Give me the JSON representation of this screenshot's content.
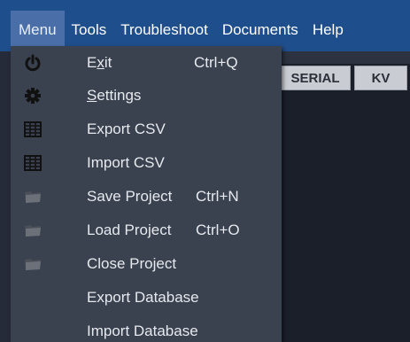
{
  "menubar": {
    "items": [
      {
        "label": "Menu",
        "active": true
      },
      {
        "label": "Tools"
      },
      {
        "label": "Troubleshoot"
      },
      {
        "label": "Documents"
      },
      {
        "label": "Help"
      }
    ]
  },
  "tabs": [
    {
      "label": "SERIAL"
    },
    {
      "label": "KV"
    }
  ],
  "menu": {
    "items": [
      {
        "label": "Exit",
        "mnemonic": "x",
        "shortcut": "Ctrl+Q",
        "icon": "power-icon"
      },
      {
        "label": "Settings",
        "mnemonic": "S",
        "shortcut": "",
        "icon": "gear-icon"
      },
      {
        "label": "Export CSV",
        "shortcut": "",
        "icon": "grid-icon"
      },
      {
        "label": "Import CSV",
        "shortcut": "",
        "icon": "grid-icon"
      },
      {
        "label": "Save Project",
        "shortcut": "Ctrl+N",
        "icon": "folder-icon"
      },
      {
        "label": "Load Project",
        "shortcut": "Ctrl+O",
        "icon": "folder-icon"
      },
      {
        "label": "Close Project",
        "shortcut": "",
        "icon": "folder-icon"
      },
      {
        "label": "Export Database",
        "shortcut": "",
        "icon": ""
      },
      {
        "label": "Import Database",
        "shortcut": "",
        "icon": ""
      }
    ]
  },
  "colors": {
    "menubar": "#1f4e8c",
    "menubar_active": "#4a6fa8",
    "dropdown": "#3a414f",
    "text": "#e6e9ee"
  }
}
